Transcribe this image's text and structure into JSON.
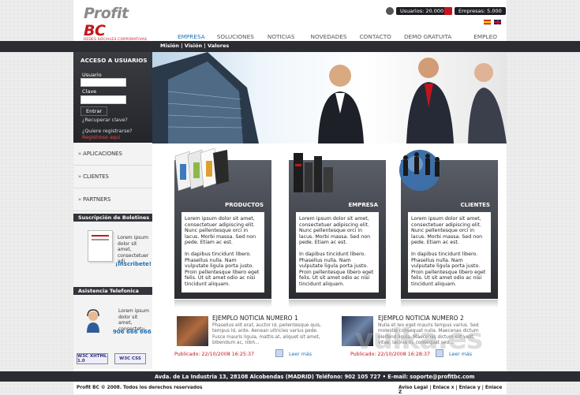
{
  "logo": {
    "name_part1": "Profit",
    "name_part2": "BC",
    "tagline": "REDES SOCIALES CORPORATIVAS"
  },
  "counters": {
    "users_label": "Usuarios",
    "users_value": "20.000",
    "companies_label": "Empresas",
    "companies_value": "5.000"
  },
  "nav": [
    "EMPRESA",
    "SOLUCIONES",
    "NOTICIAS",
    "NOVEDADES",
    "CONTACTO",
    "DEMO GRATUITA",
    "EMPLEO"
  ],
  "subnav": "Misión | Visión | Valores",
  "login": {
    "title": "ACCESO A USUARIOS",
    "user_label": "Usuario",
    "password_label": "Clave",
    "submit": "Entrar",
    "recover": "¿Recuperar clave?",
    "register_q": "¿Quiere registrarse?",
    "register_link": "Registrese aqui"
  },
  "side_links": [
    "APLICACIONES",
    "CLIENTES",
    "PARTNERS"
  ],
  "newsletter": {
    "title": "Suscripción de Boletines",
    "text": "Lorem ipsum dolor sit amet, consectetuer adi.",
    "cta": "¡Inscribete!"
  },
  "phone": {
    "title": "Asistencia Telefonica",
    "text": "Lorem ipsum dolor sit amet, consectetu.",
    "number": "906 666 666"
  },
  "badges": [
    "W3C XHTML 1.0",
    "W3C CSS"
  ],
  "cards": [
    {
      "title": "PRODUCTOS",
      "p1": "Lorem ipsum dolor sit amet, consectetuer adipiscing elit. Nunc pellentesque orci in lacus. Morbi massa. Sed non pede. Etiam ac est.",
      "p2": "In dapibus tincidunt libero. Phasellus nulla. Nam vulputate ligula porta justo. Proin pellentesque libero eget felis. Ut sit amet odio ac nisi tincidunt aliquam."
    },
    {
      "title": "EMPRESA",
      "p1": "Lorem ipsum dolor sit amet, consectetuer adipiscing elit. Nunc pellentesque orci in lacus. Morbi massa. Sed non pede. Etiam ac est.",
      "p2": "In dapibus tincidunt libero. Phasellus nulla. Nam vulputate ligula porta justo. Proin pellentesque libero eget felis. Ut sit amet odio ac nisi tincidunt aliquam."
    },
    {
      "title": "CLIENTES",
      "p1": "Lorem ipsum dolor sit amet, consectetuer adipiscing elit. Nunc pellentesque orci in lacus. Morbi massa. Sed non pede. Etiam ac est.",
      "p2": "In dapibus tincidunt libero. Phasellus nulla. Nam vulputate ligula porta justo. Proin pellentesque libero eget felis. Ut sit amet odio ac nisi tincidunt aliquam."
    }
  ],
  "news": [
    {
      "title": "EJEMPLO NOTICIA NUMERO 1",
      "text": "Phasellus elit erat, auctor id, pellentesque quis, tempus id, ante. Aenean ultricies varius pede. Fusce mauris ligula, mattis at, aliquet sit amet, bibendum ac, nibh...",
      "date": "Publicado: 22/10/2008 16:25:37",
      "more": "Leer más"
    },
    {
      "title": "EJEMPLO NOTICIA NUMERO 2",
      "text": "Nulla et leo eget mauris tempus varius. Sed molestie consequat nulla. Maecenas dictum eleifend ligula. Maecenas dictum est velit, vitae, lacinia ni, consequat sed...",
      "date": "Publicado: 22/10/2008 16:28:37",
      "more": "Leer más"
    }
  ],
  "footer": {
    "address": "Avda. de La Industria 13, 28108 Alcobendas (MADRID) Teléfono: 902 105 727 • E-mail: soporte@profitbc.com",
    "copyright": "Profit BC © 2008. Todos los derechos reservados",
    "links": "Aviso Legal | Enlace x | Enlace y | Enlace Z"
  },
  "watermark": "vulka.es"
}
